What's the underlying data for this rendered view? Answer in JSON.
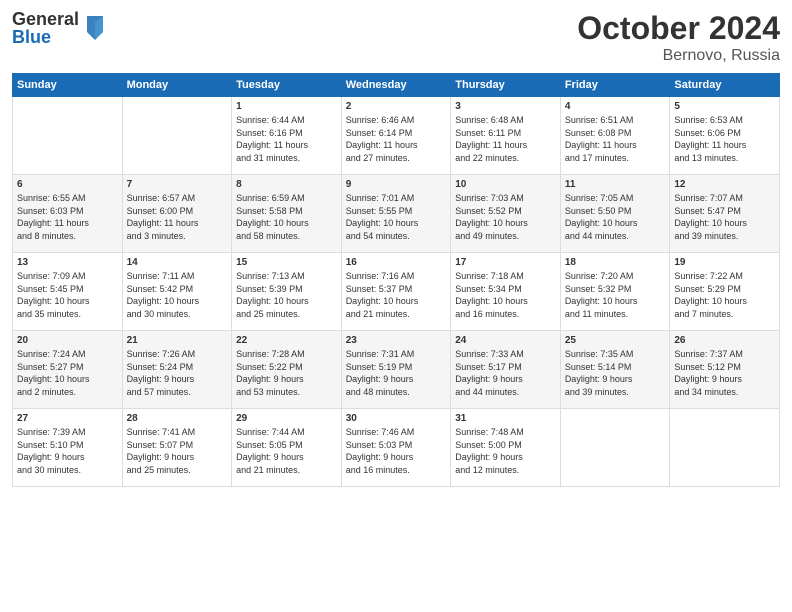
{
  "logo": {
    "general": "General",
    "blue": "Blue"
  },
  "header": {
    "month": "October 2024",
    "location": "Bernovo, Russia"
  },
  "days_of_week": [
    "Sunday",
    "Monday",
    "Tuesday",
    "Wednesday",
    "Thursday",
    "Friday",
    "Saturday"
  ],
  "weeks": [
    [
      {
        "day": "",
        "info": ""
      },
      {
        "day": "",
        "info": ""
      },
      {
        "day": "1",
        "info": "Sunrise: 6:44 AM\nSunset: 6:16 PM\nDaylight: 11 hours\nand 31 minutes."
      },
      {
        "day": "2",
        "info": "Sunrise: 6:46 AM\nSunset: 6:14 PM\nDaylight: 11 hours\nand 27 minutes."
      },
      {
        "day": "3",
        "info": "Sunrise: 6:48 AM\nSunset: 6:11 PM\nDaylight: 11 hours\nand 22 minutes."
      },
      {
        "day": "4",
        "info": "Sunrise: 6:51 AM\nSunset: 6:08 PM\nDaylight: 11 hours\nand 17 minutes."
      },
      {
        "day": "5",
        "info": "Sunrise: 6:53 AM\nSunset: 6:06 PM\nDaylight: 11 hours\nand 13 minutes."
      }
    ],
    [
      {
        "day": "6",
        "info": "Sunrise: 6:55 AM\nSunset: 6:03 PM\nDaylight: 11 hours\nand 8 minutes."
      },
      {
        "day": "7",
        "info": "Sunrise: 6:57 AM\nSunset: 6:00 PM\nDaylight: 11 hours\nand 3 minutes."
      },
      {
        "day": "8",
        "info": "Sunrise: 6:59 AM\nSunset: 5:58 PM\nDaylight: 10 hours\nand 58 minutes."
      },
      {
        "day": "9",
        "info": "Sunrise: 7:01 AM\nSunset: 5:55 PM\nDaylight: 10 hours\nand 54 minutes."
      },
      {
        "day": "10",
        "info": "Sunrise: 7:03 AM\nSunset: 5:52 PM\nDaylight: 10 hours\nand 49 minutes."
      },
      {
        "day": "11",
        "info": "Sunrise: 7:05 AM\nSunset: 5:50 PM\nDaylight: 10 hours\nand 44 minutes."
      },
      {
        "day": "12",
        "info": "Sunrise: 7:07 AM\nSunset: 5:47 PM\nDaylight: 10 hours\nand 39 minutes."
      }
    ],
    [
      {
        "day": "13",
        "info": "Sunrise: 7:09 AM\nSunset: 5:45 PM\nDaylight: 10 hours\nand 35 minutes."
      },
      {
        "day": "14",
        "info": "Sunrise: 7:11 AM\nSunset: 5:42 PM\nDaylight: 10 hours\nand 30 minutes."
      },
      {
        "day": "15",
        "info": "Sunrise: 7:13 AM\nSunset: 5:39 PM\nDaylight: 10 hours\nand 25 minutes."
      },
      {
        "day": "16",
        "info": "Sunrise: 7:16 AM\nSunset: 5:37 PM\nDaylight: 10 hours\nand 21 minutes."
      },
      {
        "day": "17",
        "info": "Sunrise: 7:18 AM\nSunset: 5:34 PM\nDaylight: 10 hours\nand 16 minutes."
      },
      {
        "day": "18",
        "info": "Sunrise: 7:20 AM\nSunset: 5:32 PM\nDaylight: 10 hours\nand 11 minutes."
      },
      {
        "day": "19",
        "info": "Sunrise: 7:22 AM\nSunset: 5:29 PM\nDaylight: 10 hours\nand 7 minutes."
      }
    ],
    [
      {
        "day": "20",
        "info": "Sunrise: 7:24 AM\nSunset: 5:27 PM\nDaylight: 10 hours\nand 2 minutes."
      },
      {
        "day": "21",
        "info": "Sunrise: 7:26 AM\nSunset: 5:24 PM\nDaylight: 9 hours\nand 57 minutes."
      },
      {
        "day": "22",
        "info": "Sunrise: 7:28 AM\nSunset: 5:22 PM\nDaylight: 9 hours\nand 53 minutes."
      },
      {
        "day": "23",
        "info": "Sunrise: 7:31 AM\nSunset: 5:19 PM\nDaylight: 9 hours\nand 48 minutes."
      },
      {
        "day": "24",
        "info": "Sunrise: 7:33 AM\nSunset: 5:17 PM\nDaylight: 9 hours\nand 44 minutes."
      },
      {
        "day": "25",
        "info": "Sunrise: 7:35 AM\nSunset: 5:14 PM\nDaylight: 9 hours\nand 39 minutes."
      },
      {
        "day": "26",
        "info": "Sunrise: 7:37 AM\nSunset: 5:12 PM\nDaylight: 9 hours\nand 34 minutes."
      }
    ],
    [
      {
        "day": "27",
        "info": "Sunrise: 7:39 AM\nSunset: 5:10 PM\nDaylight: 9 hours\nand 30 minutes."
      },
      {
        "day": "28",
        "info": "Sunrise: 7:41 AM\nSunset: 5:07 PM\nDaylight: 9 hours\nand 25 minutes."
      },
      {
        "day": "29",
        "info": "Sunrise: 7:44 AM\nSunset: 5:05 PM\nDaylight: 9 hours\nand 21 minutes."
      },
      {
        "day": "30",
        "info": "Sunrise: 7:46 AM\nSunset: 5:03 PM\nDaylight: 9 hours\nand 16 minutes."
      },
      {
        "day": "31",
        "info": "Sunrise: 7:48 AM\nSunset: 5:00 PM\nDaylight: 9 hours\nand 12 minutes."
      },
      {
        "day": "",
        "info": ""
      },
      {
        "day": "",
        "info": ""
      }
    ]
  ]
}
